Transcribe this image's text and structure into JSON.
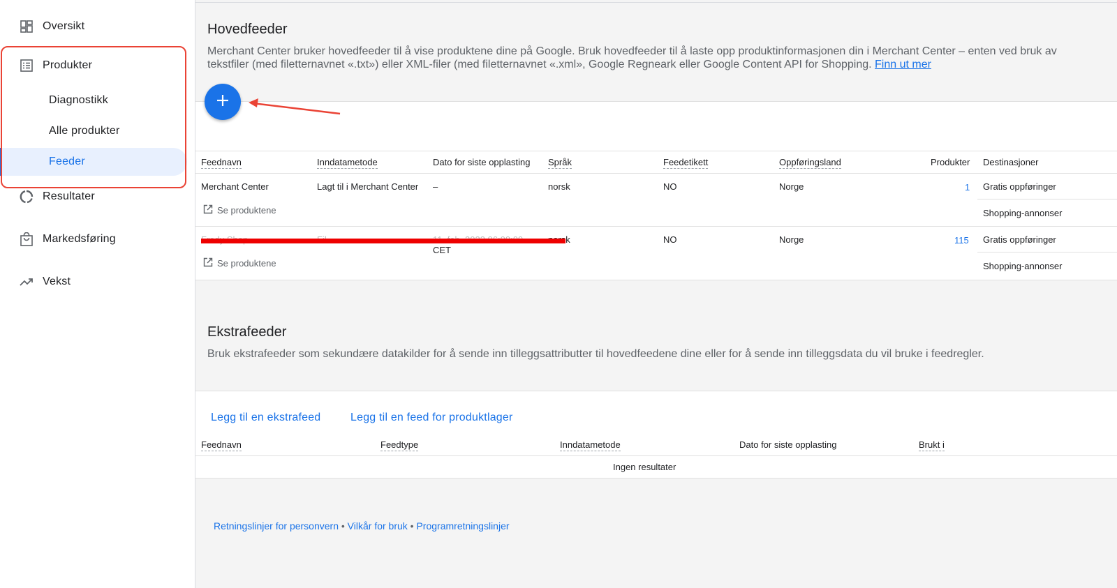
{
  "sidebar": {
    "items": [
      {
        "label": "Oversikt",
        "icon": "dashboard-icon"
      },
      {
        "label": "Produkter",
        "icon": "list-icon"
      },
      {
        "label": "Resultater",
        "icon": "donut-icon"
      },
      {
        "label": "Markedsføring",
        "icon": "shopping-bag-icon"
      },
      {
        "label": "Vekst",
        "icon": "trending-up-icon"
      }
    ],
    "sub_items": [
      {
        "label": "Diagnostikk"
      },
      {
        "label": "Alle produkter"
      },
      {
        "label": "Feeder",
        "active": true
      }
    ]
  },
  "primary": {
    "title": "Hovedfeeder",
    "description": "Merchant Center bruker hovedfeeder til å vise produktene dine på Google. Bruk hovedfeeder til å laste opp produktinformasjonen din i Merchant Center – enten ved bruk av tekstfiler (med filetternavnet «.txt») eller XML-filer (med filetternavnet «.xml», Google Regneark eller Google Content API for Shopping.",
    "learn_more": "Finn ut mer",
    "columns": [
      "Feednavn",
      "Inndatametode",
      "Dato for siste opplasting",
      "Språk",
      "Feedetikett",
      "Oppføringsland",
      "Produkter",
      "Destinasjoner"
    ],
    "rows": [
      {
        "name": "Merchant Center",
        "method": "Lagt til i Merchant Center",
        "date": "–",
        "language": "norsk",
        "label": "NO",
        "country": "Norge",
        "products": "1",
        "destinations": [
          "Gratis oppføringer",
          "Shopping-annonser"
        ],
        "see_products": "Se produktene"
      },
      {
        "name": "Fredy Shop",
        "method": "Fil",
        "date_line1": "11. feb. 2023 06:00:00",
        "date_line2": "CET",
        "language": "norsk",
        "label": "NO",
        "country": "Norge",
        "products": "115",
        "destinations": [
          "Gratis oppføringer",
          "Shopping-annonser"
        ],
        "see_products": "Se produktene"
      }
    ]
  },
  "secondary": {
    "title": "Ekstrafeeder",
    "description": "Bruk ekstrafeeder som sekundære datakilder for å sende inn tilleggsattributter til hovedfeedene dine eller for å sende inn tilleggsdata du vil bruke i feedregler.",
    "add_extra": "Legg til en ekstrafeed",
    "add_inventory": "Legg til en feed for produktlager",
    "columns": [
      "Feednavn",
      "Feedtype",
      "Inndatametode",
      "Dato for siste opplasting",
      "Brukt i"
    ],
    "empty": "Ingen resultater"
  },
  "footer": {
    "privacy": "Retningslinjer for personvern",
    "terms": "Vilkår for bruk",
    "program": "Programretningslinjer",
    "separator": " • "
  },
  "colors": {
    "accent": "#1a73e8",
    "annotation": "#ea4335"
  }
}
